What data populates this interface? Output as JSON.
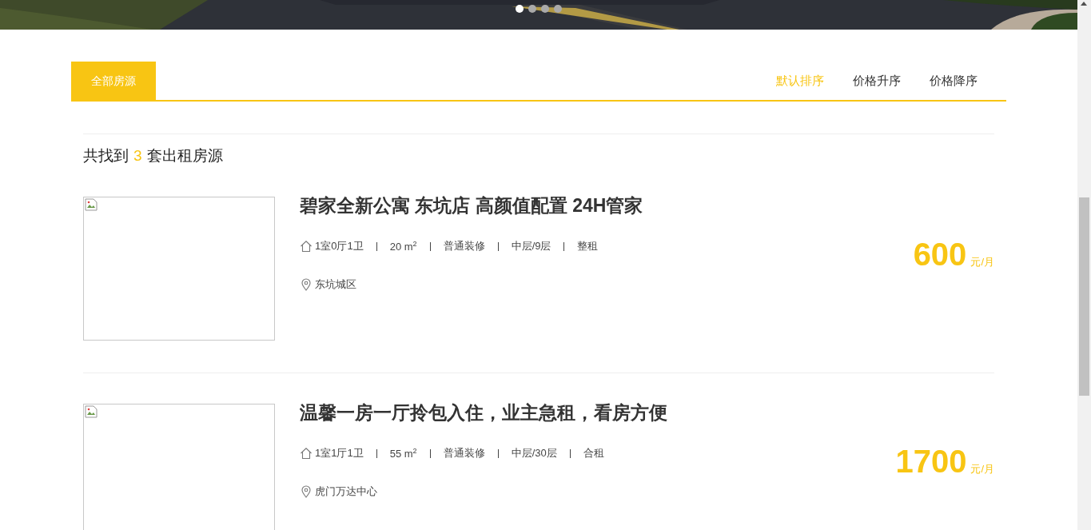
{
  "banner": {
    "kind": "picture",
    "dots": [
      {
        "selected": true
      },
      {
        "selected": false
      },
      {
        "selected": false
      },
      {
        "selected": false
      }
    ]
  },
  "tabs": [
    {
      "label": "全部房源",
      "selected": true
    }
  ],
  "sort_options": [
    {
      "label": "默认排序",
      "selected": true
    },
    {
      "label": "价格升序",
      "selected": false
    },
    {
      "label": "价格降序",
      "selected": false
    }
  ],
  "result_summary": {
    "prefix": "共找到",
    "count": "3",
    "suffix": "套出租房源"
  },
  "listings": [
    {
      "title": "碧家全新公寓 东坑店 高颜值配置 24H管家",
      "layout": "1室0厅1卫",
      "area": "20 m$^{2}$",
      "decoration": "普通装修",
      "floor": "中层/9层",
      "rent_type": "整租",
      "location": "东坑城区",
      "price": "600",
      "price_unit": "元/月"
    },
    {
      "title": "温馨一房一厅拎包入住，业主急租，看房方便",
      "layout": "1室1厅1卫",
      "area": "55 m$^{2}$",
      "decoration": "普通装修",
      "floor": "中层/30层",
      "rent_type": "合租",
      "location": "虎门万达中心",
      "price": "1700",
      "price_unit": "元/月"
    }
  ]
}
